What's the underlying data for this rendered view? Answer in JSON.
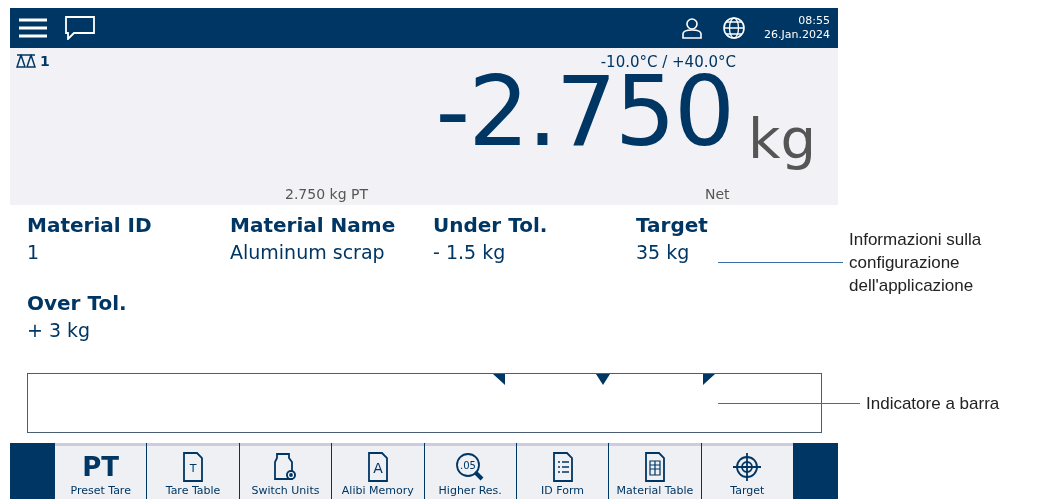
{
  "header": {
    "time": "08:55",
    "date": "26.Jan.2024"
  },
  "scale": {
    "label": "1",
    "temperature_range": "-10.0°C / +40.0°C",
    "weight": "-2.750",
    "unit": "kg",
    "tare": "2.750 kg PT",
    "mode": "Net"
  },
  "fields": [
    {
      "label": "Material ID",
      "value": "1"
    },
    {
      "label": "Material Name",
      "value": "Aluminum scrap"
    },
    {
      "label": "Under Tol.",
      "value": "- 1.5 kg"
    },
    {
      "label": "Target",
      "value": "35 kg"
    },
    {
      "label": "Over Tol.",
      "value": "+ 3 kg"
    }
  ],
  "softkeys": [
    {
      "glyph": "PT",
      "label": "Preset Tare"
    },
    {
      "icon_text": "T",
      "label": "Tare Table"
    },
    {
      "label": "Switch Units"
    },
    {
      "icon_text": "A",
      "label": "Alibi Memory"
    },
    {
      "icon_text": ".05",
      "label": "Higher Res."
    },
    {
      "label": "ID Form"
    },
    {
      "label": "Material Table"
    },
    {
      "label": "Target"
    }
  ],
  "annotations": [
    {
      "text": "Informazioni sulla configurazione dell'applicazione"
    },
    {
      "text": "Indicatore a barra"
    }
  ]
}
